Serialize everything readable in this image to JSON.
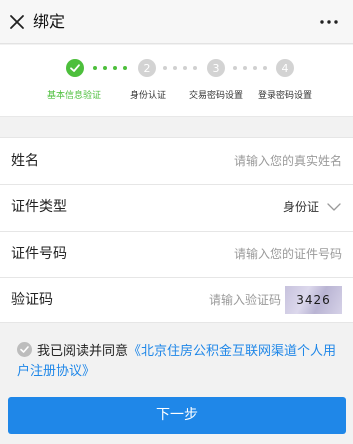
{
  "nav": {
    "title": "绑定"
  },
  "stepper": {
    "steps": [
      {
        "number": "",
        "label": "基本信息验证",
        "state": "done"
      },
      {
        "number": "2",
        "label": "身份认证",
        "state": "todo"
      },
      {
        "number": "3",
        "label": "交易密码设置",
        "state": "todo"
      },
      {
        "number": "4",
        "label": "登录密码设置",
        "state": "todo"
      }
    ],
    "accent_color": "#4dbf3c",
    "inactive_color": "#d3d3d3"
  },
  "form": {
    "name": {
      "label": "姓名",
      "placeholder": "请输入您的真实姓名"
    },
    "id_type": {
      "label": "证件类型",
      "value": "身份证"
    },
    "id_number": {
      "label": "证件号码",
      "placeholder": "请输入您的证件号码"
    },
    "captcha": {
      "label": "验证码",
      "placeholder": "请输入验证码",
      "code": "3426"
    }
  },
  "agreement": {
    "prefix": "我已阅读并同意",
    "link": "《北京住房公积金互联网渠道个人用户注册协议》"
  },
  "actions": {
    "next_label": "下一步",
    "button_color": "#1f87e8"
  }
}
